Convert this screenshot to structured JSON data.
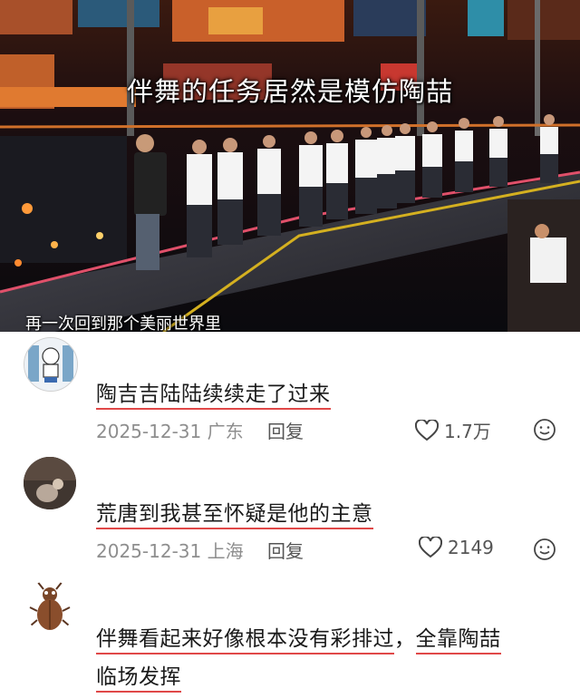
{
  "video": {
    "title": "伴舞的任务居然是模仿陶喆",
    "subtitle": "再一次回到那个美丽世界里"
  },
  "comments": [
    {
      "text": "陶吉吉陆陆续续走了过来",
      "date": "2025-12-31",
      "location": "广东",
      "reply_label": "回复",
      "likes": "1.7万"
    },
    {
      "text": "荒唐到我甚至怀疑是他的主意",
      "date": "2025-12-31",
      "location": "上海",
      "reply_label": "回复",
      "likes": "2149"
    },
    {
      "text_line1_a": "伴舞看起来好像根本没有彩排过",
      "text_line1_b": "，",
      "text_line1_c": "全靠陶喆",
      "text_line2": "临场发挥"
    }
  ],
  "icons": {
    "like": "heart-outline-icon",
    "emoji": "smiley-icon"
  },
  "colors": {
    "underline": "#e04848",
    "meta": "#8e8e8e"
  }
}
